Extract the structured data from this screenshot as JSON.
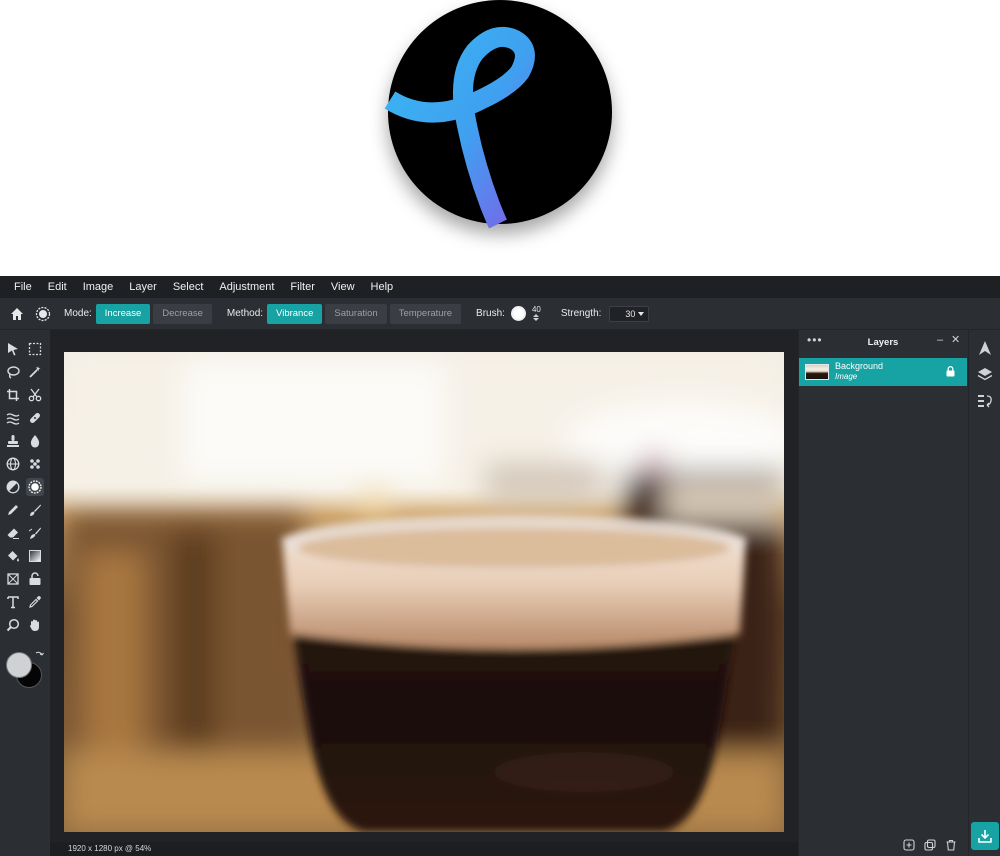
{
  "menu": [
    "File",
    "Edit",
    "Image",
    "Layer",
    "Select",
    "Adjustment",
    "Filter",
    "View",
    "Help"
  ],
  "options": {
    "mode_label": "Mode:",
    "mode_options": [
      "Increase",
      "Decrease"
    ],
    "mode_selected": "Increase",
    "method_label": "Method:",
    "method_options": [
      "Vibrance",
      "Saturation",
      "Temperature"
    ],
    "method_selected": "Vibrance",
    "brush_label": "Brush:",
    "brush_size": "40",
    "strength_label": "Strength:",
    "strength_value": "30"
  },
  "tools": [
    "move-tool",
    "marquee-tool",
    "lasso-tool",
    "magic-wand-tool",
    "crop-tool",
    "slice-tool",
    "liquify-tool",
    "healing-tool",
    "stamp-tool",
    "blur-tool",
    "sponge-tool",
    "dodge-burn-tool",
    "brightness-tool",
    "saturation-tool",
    "pencil-tool",
    "brush-tool",
    "eraser-tool",
    "smudge-tool",
    "fill-tool",
    "gradient-tool",
    "shape-tool",
    "pattern-tool",
    "text-tool",
    "eyedropper-tool",
    "zoom-tool",
    "hand-tool"
  ],
  "colors": {
    "accent": "#17a3a3",
    "foreground": "#cfd1d4",
    "background": "#050505"
  },
  "status": {
    "text": "1920 x 1280 px @ 54%"
  },
  "layers": {
    "title": "Layers",
    "items": [
      {
        "name": "Background",
        "type": "Image",
        "locked": true
      }
    ]
  }
}
